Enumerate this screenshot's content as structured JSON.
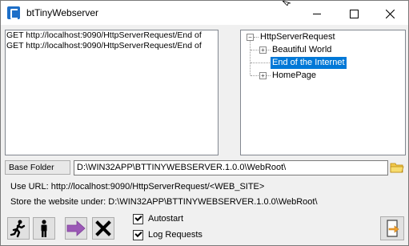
{
  "window": {
    "title": "btTinyWebserver"
  },
  "log": {
    "lines": [
      "GET http://localhost:9090/HttpServerRequest/End of",
      "GET http://localhost:9090/HttpServerRequest/End of"
    ]
  },
  "tree": {
    "root": "HttpServerRequest",
    "children": [
      {
        "label": "Beautiful World",
        "expander": "+"
      },
      {
        "label": "End of the Internet",
        "expander": "",
        "selected": true
      },
      {
        "label": "HomePage",
        "expander": "+"
      }
    ],
    "root_expander": "−"
  },
  "base_folder": {
    "label": "Base Folder",
    "value": "D:\\WIN32APP\\BTTINYWEBSERVER.1.0.0\\WebRoot\\"
  },
  "info": {
    "use_url": "Use URL: http://localhost:9090/HttpServerRequest/<WEB_SITE>",
    "store": "Store the website under: D:\\WIN32APP\\BTTINYWEBSERVER.1.0.0\\WebRoot\\"
  },
  "options": {
    "autostart_label": "Autostart",
    "autostart_checked": true,
    "log_requests_label": "Log Requests",
    "log_requests_checked": true
  },
  "colors": {
    "selection": "#0078d7",
    "arrow_purple": "#9b59b6",
    "exit_orange": "#f0a030"
  },
  "icons": [
    "app-icon",
    "running-man-icon",
    "standing-man-icon",
    "arrow-right-icon",
    "close-x-icon",
    "folder-icon",
    "exit-door-icon"
  ]
}
